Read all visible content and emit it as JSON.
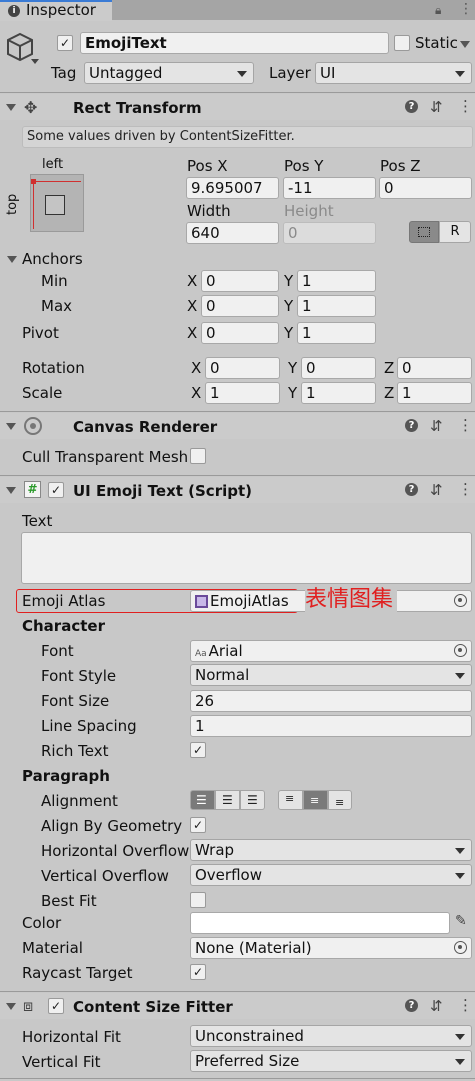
{
  "tab": {
    "title": "Inspector"
  },
  "object": {
    "name": "EmojiText",
    "static_label": "Static",
    "tag_label": "Tag",
    "tag_value": "Untagged",
    "layer_label": "Layer",
    "layer_value": "UI"
  },
  "rect_transform": {
    "title": "Rect Transform",
    "driven_note": "Some values driven by ContentSizeFitter.",
    "anchor_h": "left",
    "anchor_v": "top",
    "pos_x_label": "Pos X",
    "pos_y_label": "Pos Y",
    "pos_z_label": "Pos Z",
    "pos_x": "9.695007",
    "pos_y": "-11",
    "pos_z": "0",
    "width_label": "Width",
    "height_label": "Height",
    "width": "640",
    "height": "0",
    "raw_button": "R",
    "anchors_label": "Anchors",
    "min_label": "Min",
    "max_label": "Max",
    "pivot_label": "Pivot",
    "min_x": "0",
    "min_y": "1",
    "max_x": "0",
    "max_y": "1",
    "pivot_x": "0",
    "pivot_y": "1",
    "rotation_label": "Rotation",
    "scale_label": "Scale",
    "rot_x": "0",
    "rot_y": "0",
    "rot_z": "0",
    "scale_x": "1",
    "scale_y": "1",
    "scale_z": "1",
    "axis_x": "X",
    "axis_y": "Y",
    "axis_z": "Z"
  },
  "canvas_renderer": {
    "title": "Canvas Renderer",
    "cull_label": "Cull Transparent Mesh"
  },
  "emoji_text": {
    "title": "UI Emoji Text (Script)",
    "text_label": "Text",
    "atlas_label": "Emoji Atlas",
    "atlas_value": "EmojiAtlas",
    "atlas_annotation": "表情图集",
    "character_label": "Character",
    "font_label": "Font",
    "font_value": "Arial",
    "font_icon": "Aa",
    "font_style_label": "Font Style",
    "font_style_value": "Normal",
    "font_size_label": "Font Size",
    "font_size_value": "26",
    "line_spacing_label": "Line Spacing",
    "line_spacing_value": "1",
    "rich_text_label": "Rich Text",
    "paragraph_label": "Paragraph",
    "alignment_label": "Alignment",
    "align_geom_label": "Align By Geometry",
    "h_overflow_label": "Horizontal Overflow",
    "h_overflow_value": "Wrap",
    "v_overflow_label": "Vertical Overflow",
    "v_overflow_value": "Overflow",
    "best_fit_label": "Best Fit",
    "color_label": "Color",
    "material_label": "Material",
    "material_value": "None (Material)",
    "raycast_label": "Raycast Target",
    "check": "✓"
  },
  "content_size_fitter": {
    "title": "Content Size Fitter",
    "h_fit_label": "Horizontal Fit",
    "h_fit_value": "Unconstrained",
    "v_fit_label": "Vertical Fit",
    "v_fit_value": "Preferred Size"
  },
  "colors": {
    "annotation_red": "#e02020",
    "panel_bg": "#c8c8c8"
  }
}
